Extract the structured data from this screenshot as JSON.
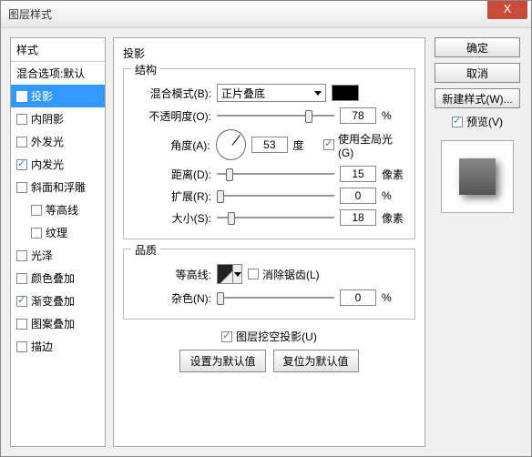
{
  "window": {
    "title": "图层样式",
    "close": "X"
  },
  "sidebar": {
    "header": "样式",
    "blend_defaults": "混合选项:默认",
    "items": [
      {
        "label": "投影",
        "checked": true,
        "selected": true
      },
      {
        "label": "内阴影",
        "checked": false
      },
      {
        "label": "外发光",
        "checked": false
      },
      {
        "label": "内发光",
        "checked": true
      },
      {
        "label": "斜面和浮雕",
        "checked": false
      },
      {
        "label": "等高线",
        "checked": false,
        "indent": true
      },
      {
        "label": "纹理",
        "checked": false,
        "indent": true
      },
      {
        "label": "光泽",
        "checked": false
      },
      {
        "label": "颜色叠加",
        "checked": false
      },
      {
        "label": "渐变叠加",
        "checked": true
      },
      {
        "label": "图案叠加",
        "checked": false
      },
      {
        "label": "描边",
        "checked": false
      }
    ]
  },
  "panel": {
    "title": "投影",
    "structure": {
      "legend": "结构",
      "blend_mode_label": "混合模式(B):",
      "blend_mode_value": "正片叠底",
      "color": "#000000",
      "opacity_label": "不透明度(O):",
      "opacity_value": "78",
      "opacity_unit": "%",
      "angle_label": "角度(A):",
      "angle_value": "53",
      "angle_unit": "度",
      "global_light_label": "使用全局光(G)",
      "global_light_checked": true,
      "distance_label": "距离(D):",
      "distance_value": "15",
      "distance_unit": "像素",
      "spread_label": "扩展(R):",
      "spread_value": "0",
      "spread_unit": "%",
      "size_label": "大小(S):",
      "size_value": "18",
      "size_unit": "像素"
    },
    "quality": {
      "legend": "品质",
      "contour_label": "等高线:",
      "antialias_label": "消除锯齿(L)",
      "antialias_checked": false,
      "noise_label": "杂色(N):",
      "noise_value": "0",
      "noise_unit": "%"
    },
    "knockout": {
      "label": "图层挖空投影(U)",
      "checked": true
    },
    "set_default": "设置为默认值",
    "reset_default": "复位为默认值"
  },
  "buttons": {
    "ok": "确定",
    "cancel": "取消",
    "new_style": "新建样式(W)...",
    "preview_label": "预览(V)",
    "preview_checked": true
  }
}
